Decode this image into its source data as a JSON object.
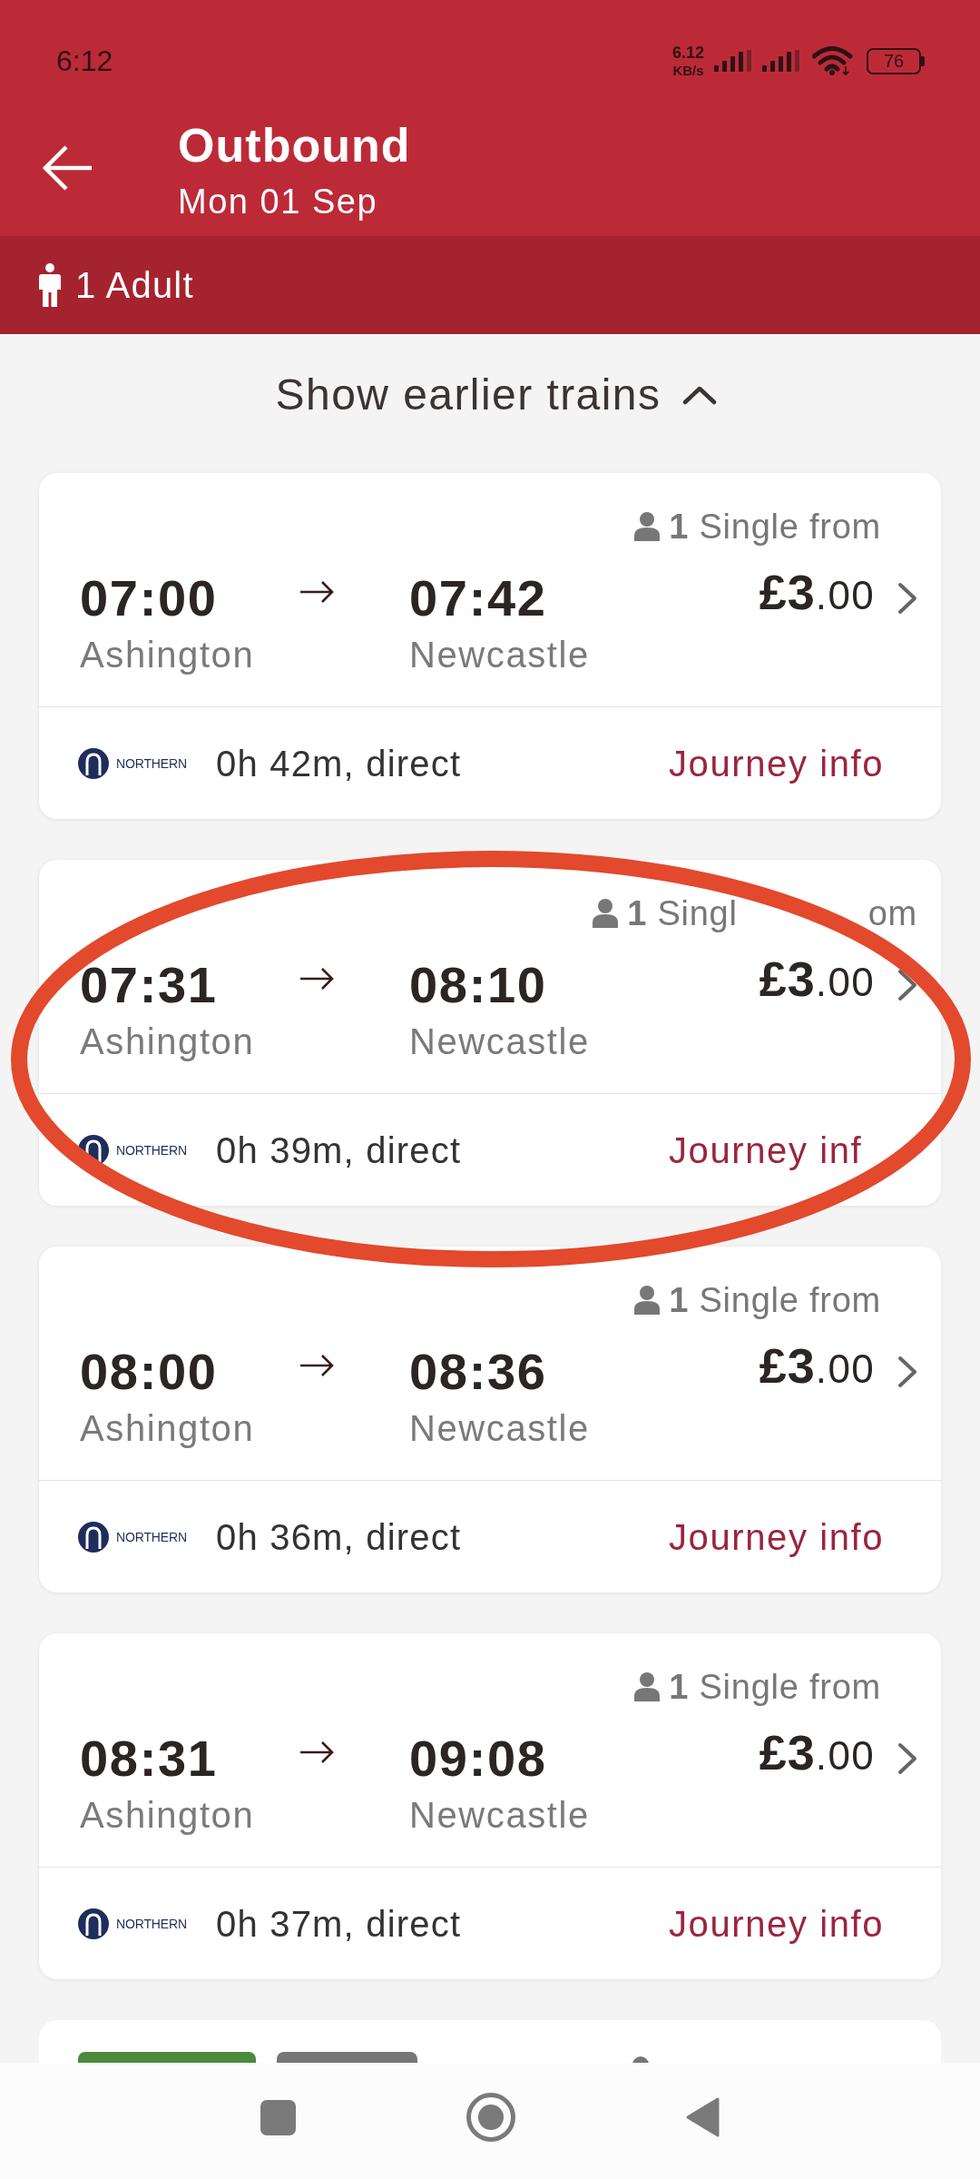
{
  "status_bar": {
    "time": "6:12",
    "network_speed": "6.12",
    "network_unit": "KB/s",
    "battery": "76"
  },
  "header": {
    "title": "Outbound",
    "subtitle": "Mon 01 Sep"
  },
  "passengers": {
    "label": "1 Adult"
  },
  "earlier_trains": {
    "label": "Show earlier trains"
  },
  "journeys": [
    {
      "fare": "**1** Single from",
      "depart": "07:00",
      "arrive": "07:42",
      "origin": "Ashington",
      "destination": "Newcastle",
      "price": "£3.00",
      "operator": "NORTHERN",
      "duration": "0h 42m, direct",
      "link": "Journey info",
      "circled": false
    },
    {
      "fare": "**1** Singl",
      "fare_tail": "om",
      "depart": "07:31",
      "arrive": "08:10",
      "origin": "Ashington",
      "destination": "Newcastle",
      "price": "£3.00",
      "operator": "NORTHERN",
      "duration": "0h 39m, direct",
      "link": "Journey inf",
      "circled": true
    },
    {
      "fare": "**1** Single from",
      "depart": "08:00",
      "arrive": "08:36",
      "origin": "Ashington",
      "destination": "Newcastle",
      "price": "£3.00",
      "operator": "NORTHERN",
      "duration": "0h 36m, direct",
      "link": "Journey info",
      "circled": false
    },
    {
      "fare": "**1** Single from",
      "depart": "08:31",
      "arrive": "09:08",
      "origin": "Ashington",
      "destination": "Newcastle",
      "price": "£3.00",
      "operator": "NORTHERN",
      "duration": "0h 37m, direct",
      "link": "Journey info",
      "circled": false
    }
  ],
  "partial_journey": {
    "tags": [
      {
        "color": "#4a8a3a"
      },
      {
        "color": "#767676"
      }
    ]
  }
}
